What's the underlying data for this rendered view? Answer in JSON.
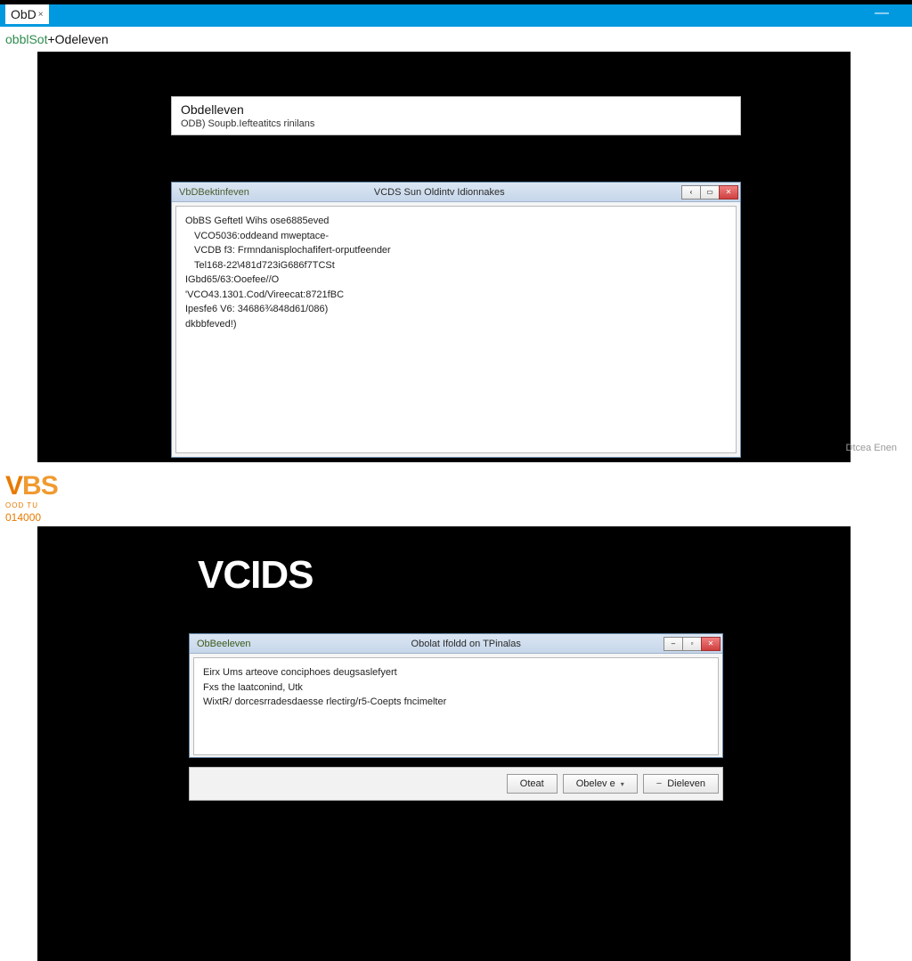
{
  "window": {
    "title": "ObD",
    "title_suffix": "×",
    "minimize_glyph": "—",
    "close_glyph": ""
  },
  "secondary": {
    "brand_left": "obblSot",
    "brand_mid": "+",
    "brand_right": " Odeleven"
  },
  "header_box": {
    "title": "Obdelleven",
    "subtitle": "ODB) Soupb.Iefteatitcs rinilans"
  },
  "dialog1": {
    "title_left": "VbDBektinfeven",
    "title_center": "VCDS Sun Oldintv Idionnakes",
    "win_min": "‹",
    "win_max": "▭",
    "win_close": "✕",
    "lines": [
      "ObBS Geftetl Wihs ose6885eved",
      "VCO5036:oddeand mweptace-",
      "VCDB f3: Frmndanisplochafifert-orputfeender",
      "Tel168-22\\481d723iG686f7TCSt",
      "IGbd65/63:Ooefee//O",
      "'VCO43.1301.Cod/Vireecat:8721fBC",
      "Ipesfe6 V6: 34686¾848d61/086)",
      "dkbbfeved!)"
    ]
  },
  "panel1": {
    "side_text": "Dtcea Enen"
  },
  "logo": {
    "v": "V",
    "b": "B",
    "s": "S",
    "sub1": "OOD TU",
    "sub2": "014000"
  },
  "vcds_title": "VCIDS",
  "dialog2": {
    "title_left": "ObBeeleven",
    "title_center": "Obolat Ifoldd on TPinalas",
    "win_min": "–",
    "win_max": "▫",
    "win_close": "✕",
    "lines": [
      "Eirx Ums arteove conciphoes deugsaslefyert",
      "Fxs the laatconind, Utk",
      "WixtR/ dorcesrradesdaesse rlectirg/r5-Coepts fncimelter"
    ]
  },
  "buttons": {
    "b1": "Oteat",
    "b2": "Obelev e",
    "b3": "Dieleven"
  }
}
